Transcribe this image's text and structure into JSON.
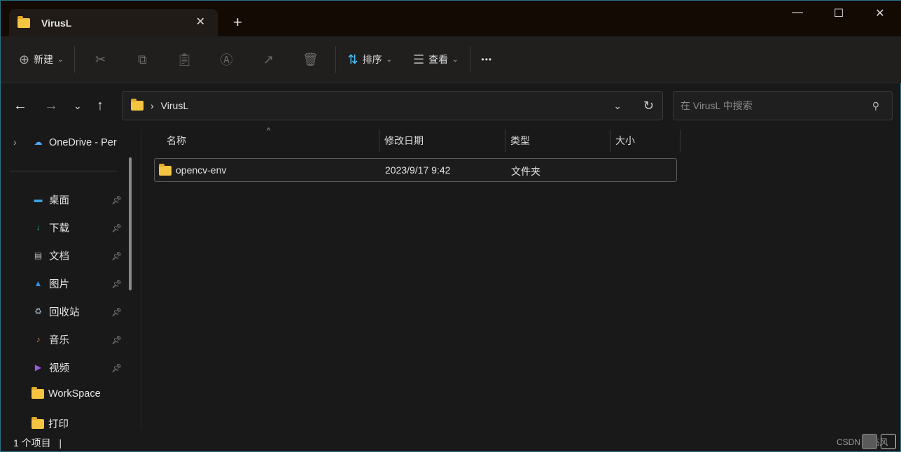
{
  "tab": {
    "title": "VirusL",
    "close": "✕",
    "new": "+"
  },
  "window": {
    "minimize": "—",
    "maximize": "☐",
    "close": "✕"
  },
  "toolbar": {
    "new_label": "新建",
    "sort_label": "排序",
    "view_label": "查看",
    "more": "•••"
  },
  "address": {
    "sep": "›",
    "path": "VirusL"
  },
  "search": {
    "placeholder": "在 VirusL 中搜索"
  },
  "sidebar": {
    "onedrive": "OneDrive - Per",
    "items": [
      {
        "label": "桌面",
        "icon": "desktop-icon",
        "pinned": true
      },
      {
        "label": "下载",
        "icon": "download-icon",
        "pinned": true
      },
      {
        "label": "文档",
        "icon": "documents-icon",
        "pinned": true
      },
      {
        "label": "图片",
        "icon": "pictures-icon",
        "pinned": true
      },
      {
        "label": "回收站",
        "icon": "recycle-bin-icon",
        "pinned": true
      },
      {
        "label": "音乐",
        "icon": "music-icon",
        "pinned": true
      },
      {
        "label": "视频",
        "icon": "videos-icon",
        "pinned": true
      },
      {
        "label": "WorkSpace",
        "icon": "folder-icon",
        "pinned": false
      },
      {
        "label": "打印",
        "icon": "folder-icon",
        "pinned": false
      }
    ]
  },
  "columns": {
    "name": "名称",
    "modified": "修改日期",
    "type": "类型",
    "size": "大小"
  },
  "files": [
    {
      "name": "opencv-env",
      "modified": "2023/9/17 9:42",
      "type": "文件夹",
      "size": ""
    }
  ],
  "status": {
    "count": "1 个项目",
    "cursor": "|"
  },
  "watermark": "CSDN @临风"
}
